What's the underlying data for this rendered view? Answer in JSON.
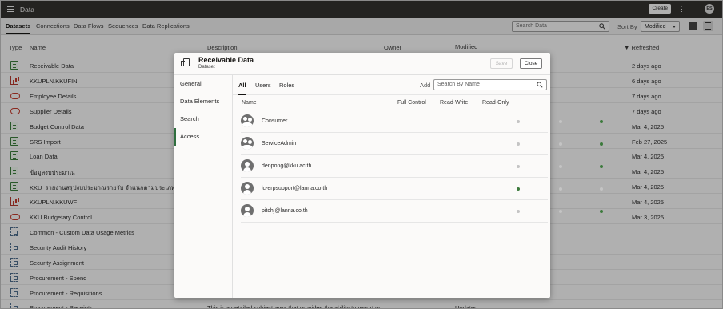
{
  "app": {
    "title": "Data",
    "create_label": "Create",
    "user_initials": "ES"
  },
  "tabs": [
    "Datasets",
    "Connections",
    "Data Flows",
    "Sequences",
    "Data Replications"
  ],
  "search": {
    "placeholder": "Search Data"
  },
  "sort": {
    "label": "Sort By",
    "value": "Modified"
  },
  "columns": {
    "type": "Type",
    "name": "Name",
    "description": "Description",
    "owner": "Owner",
    "modified": "Modified",
    "refreshed": "Refreshed"
  },
  "rows": [
    {
      "name": "Receivable Data",
      "description": "",
      "modified": "",
      "refreshed": "2 days ago",
      "icon": "dataset-icon"
    },
    {
      "name": "KKUPLN.KKUFIN",
      "description": "",
      "modified": "",
      "refreshed": "6 days ago",
      "icon": "chart-icon"
    },
    {
      "name": "Employee Details",
      "description": "",
      "modified": "",
      "refreshed": "7 days ago",
      "icon": "cloud-icon"
    },
    {
      "name": "Supplier Details",
      "description": "",
      "modified": "",
      "refreshed": "7 days ago",
      "icon": "cloud-icon"
    },
    {
      "name": "Budget Control Data",
      "description": "",
      "modified": "",
      "refreshed": "Mar 4, 2025",
      "icon": "dataset-icon"
    },
    {
      "name": "SRS Import",
      "description": "",
      "modified": "",
      "refreshed": "Feb 27, 2025",
      "icon": "dataset-icon"
    },
    {
      "name": "Loan Data",
      "description": "",
      "modified": "",
      "refreshed": "Mar 4, 2025",
      "icon": "dataset-icon"
    },
    {
      "name": "ข้อมูลงบประมาณ",
      "description": "",
      "modified": "",
      "refreshed": "Mar 4, 2025",
      "icon": "dataset-icon"
    },
    {
      "name": "KKU_รายงานสรุปงบประมาณรายรับ จำแนกตามประเภทรายรับ",
      "description": "",
      "modified": "",
      "refreshed": "Mar 4, 2025",
      "icon": "dataset-icon"
    },
    {
      "name": "KKUPLN.KKUWF",
      "description": "",
      "modified": "",
      "refreshed": "Mar 4, 2025",
      "icon": "chart-icon"
    },
    {
      "name": "KKU Budgetary Control",
      "description": "",
      "modified": "",
      "refreshed": "Mar 3, 2025",
      "icon": "cloud-icon"
    },
    {
      "name": "Common - Custom Data Usage Metrics",
      "description": "",
      "modified": "",
      "refreshed": "",
      "icon": "subject-area-icon"
    },
    {
      "name": "Security Audit History",
      "description": "",
      "modified": "",
      "refreshed": "",
      "icon": "subject-area-icon"
    },
    {
      "name": "Security Assignment",
      "description": "",
      "modified": "",
      "refreshed": "",
      "icon": "subject-area-icon"
    },
    {
      "name": "Procurement - Spend",
      "description": "",
      "modified": "",
      "refreshed": "",
      "icon": "subject-area-icon"
    },
    {
      "name": "Procurement - Requisitions",
      "description": "",
      "modified": "",
      "refreshed": "",
      "icon": "subject-area-icon"
    },
    {
      "name": "Procurement - Receipts",
      "description": "This is a detailed subject area that provides the ability to report on ...",
      "modified": "Updated",
      "refreshed": "",
      "icon": "subject-area-icon"
    }
  ],
  "modal": {
    "title": "Receivable Data",
    "subtitle": "Dataset",
    "save_label": "Save",
    "close_label": "Close",
    "nav": [
      "General",
      "Data Elements",
      "Search",
      "Access"
    ],
    "active_nav": "Access",
    "access_tabs": [
      "All",
      "Users",
      "Roles"
    ],
    "add_label": "Add",
    "search_placeholder": "Search By Name",
    "headers": {
      "name": "Name",
      "full_control": "Full Control",
      "read_write": "Read-Write",
      "read_only": "Read-Only"
    },
    "users": [
      {
        "name": "Consumer",
        "kind": "group",
        "permission": "read_only"
      },
      {
        "name": "ServiceAdmin",
        "kind": "group",
        "permission": "read_only"
      },
      {
        "name": "denpong@kku.ac.th",
        "kind": "user",
        "permission": "read_only"
      },
      {
        "name": "lc-erpsupport@lanna.co.th",
        "kind": "user",
        "permission": "full_control"
      },
      {
        "name": "pitchj@lanna.co.th",
        "kind": "user",
        "permission": "read_only"
      }
    ],
    "colors": {
      "selected": "#3c7a3c",
      "unselected": "#c4c4c4"
    }
  }
}
